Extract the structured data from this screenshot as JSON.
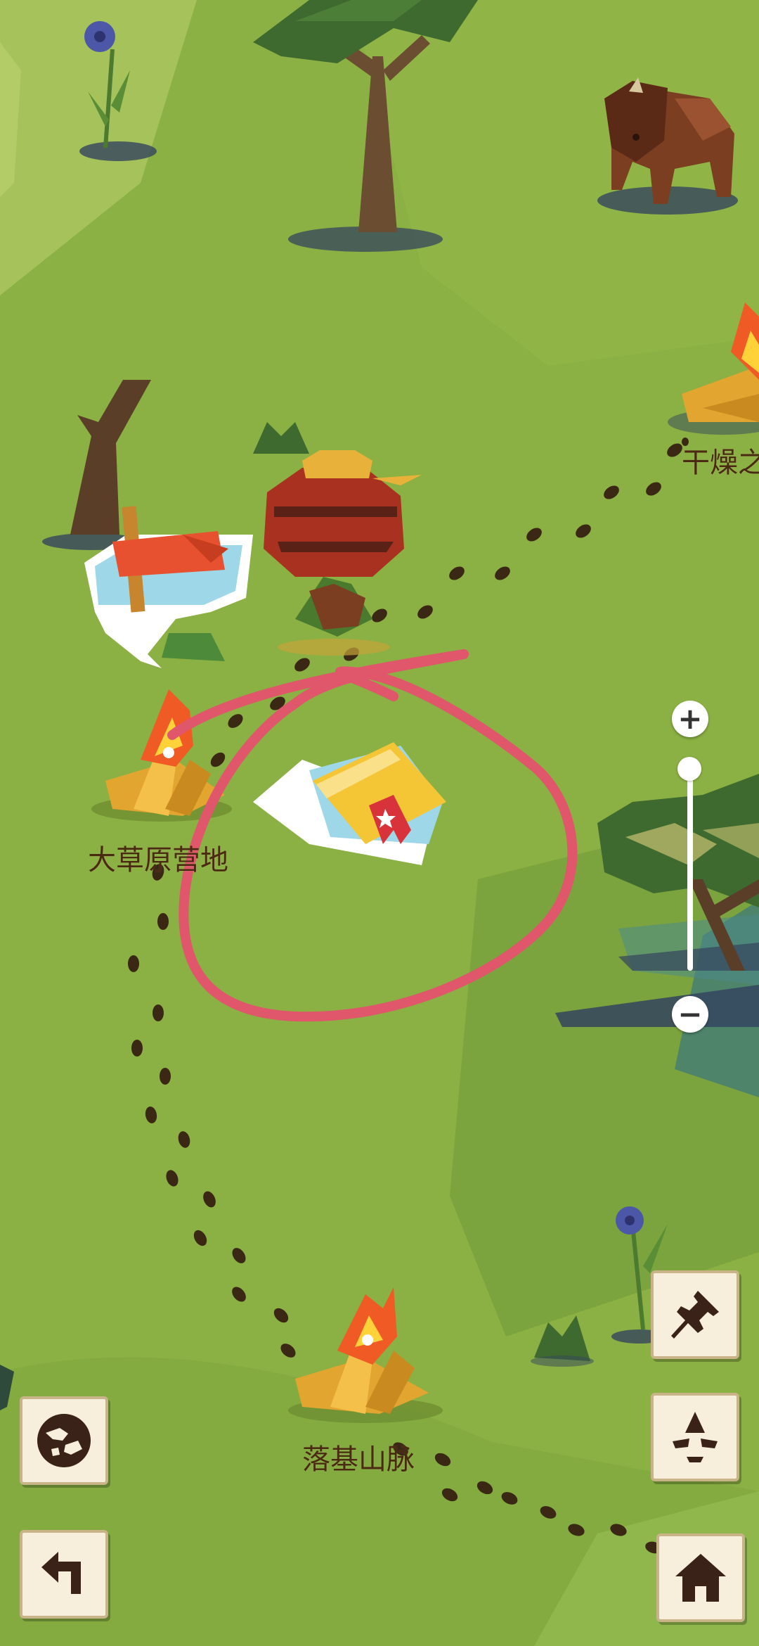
{
  "map": {
    "campsites": [
      {
        "name": "干燥之"
      },
      {
        "name": "大草原营地"
      },
      {
        "name": "落基山脉"
      }
    ]
  },
  "zoom": {
    "plus_label": "+",
    "minus_label": "−",
    "level": 0.0
  },
  "buttons": {
    "left": [
      {
        "icon": "world-map-icon"
      },
      {
        "icon": "back-arrow-icon"
      }
    ],
    "right": [
      {
        "icon": "pin-icon"
      },
      {
        "icon": "center-location-icon"
      },
      {
        "icon": "home-icon"
      }
    ]
  },
  "colors": {
    "grass": "#8fb344",
    "grass_dark": "#7aa23a",
    "grass_light": "#a3c35a",
    "circle": "#e0566a",
    "fire_orange": "#f05a24",
    "wood": "#e2a530",
    "book": "#f4c534",
    "flag": "#e8512f"
  }
}
